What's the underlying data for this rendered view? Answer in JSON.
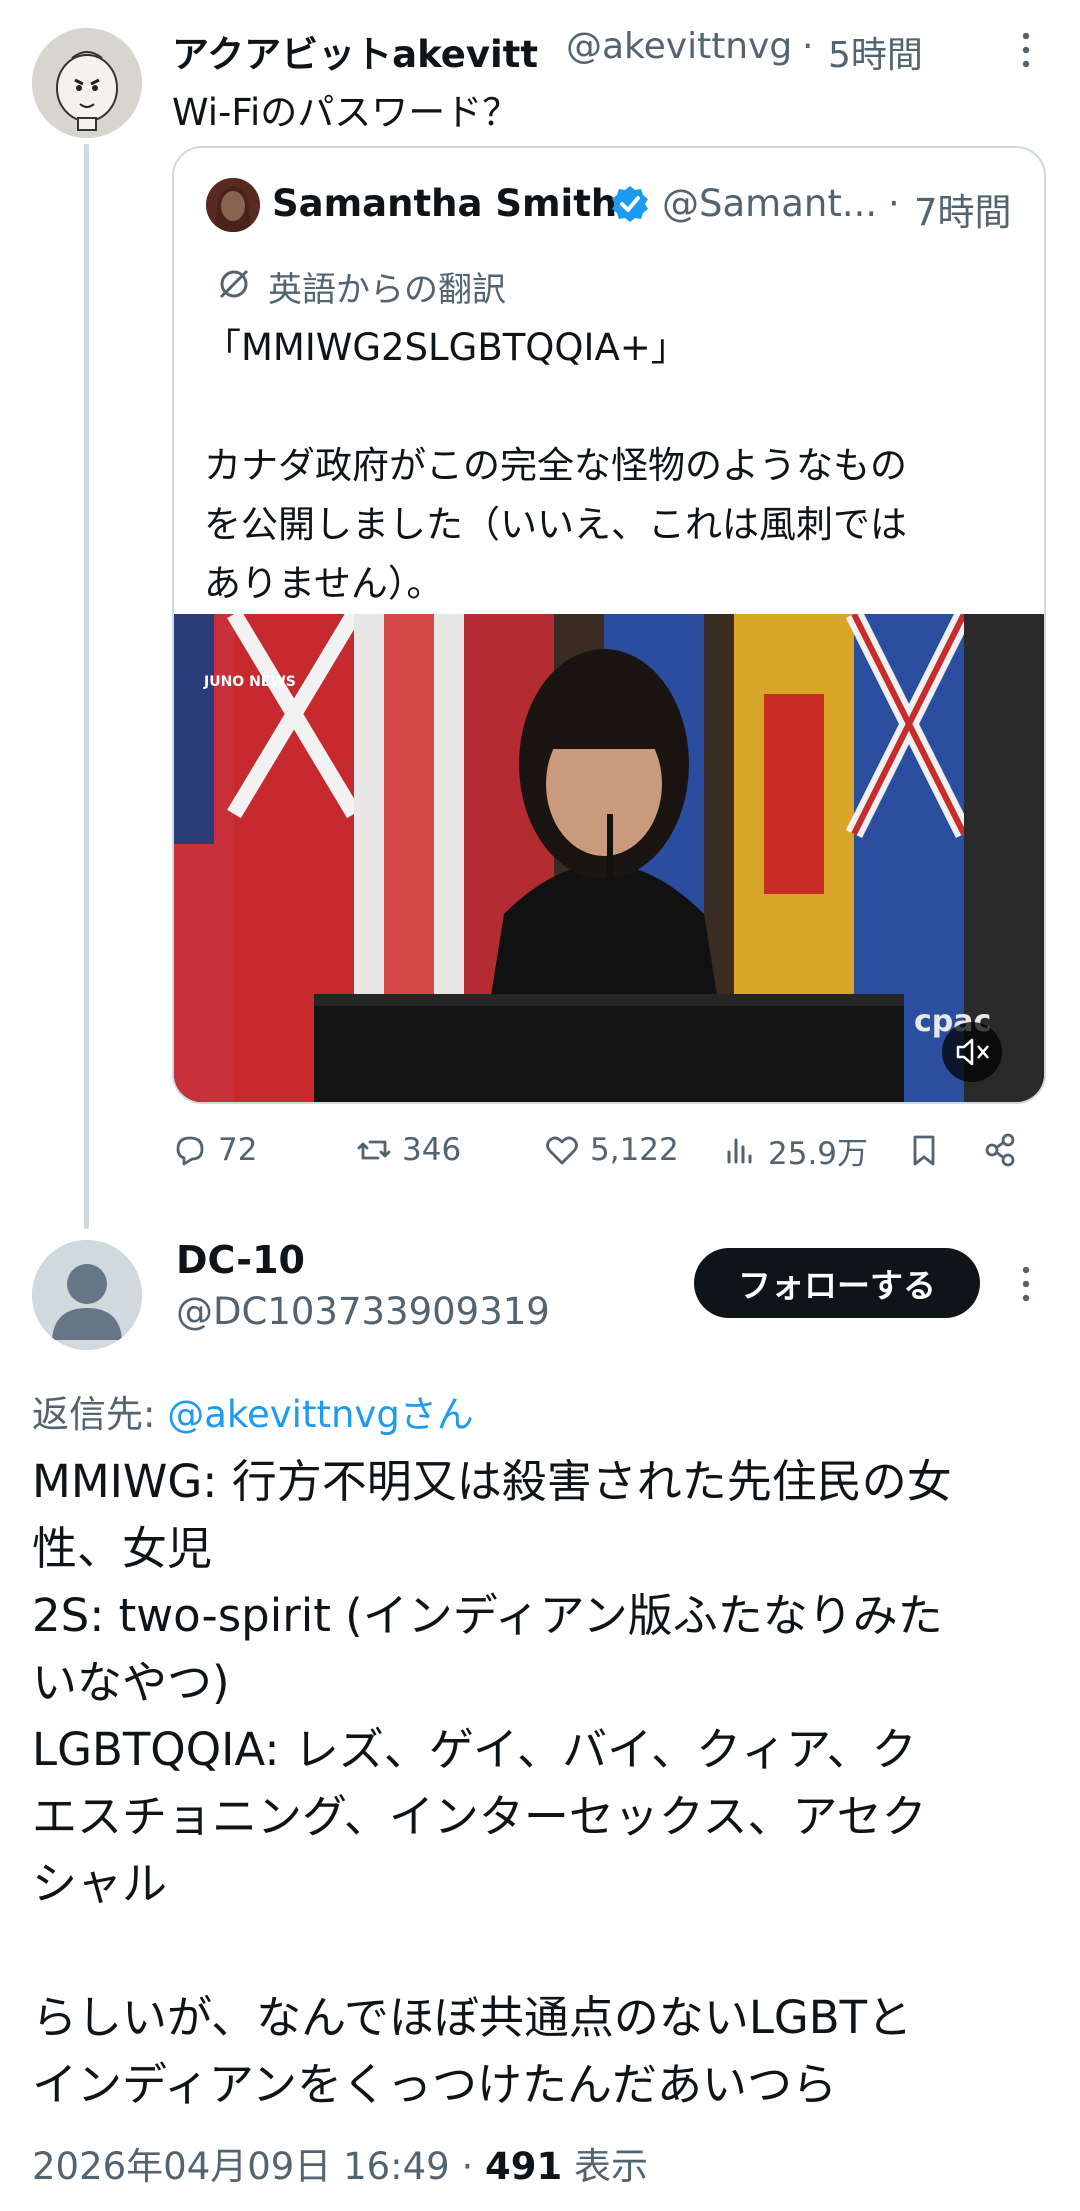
{
  "parent_tweet": {
    "display_name": "アクアビットakevitt",
    "handle": "@akevittnvg",
    "separator": "·",
    "time": "5時間",
    "text": "Wi-Fiのパスワード？"
  },
  "quoted_tweet": {
    "display_name": "Samantha Smith",
    "handle": "@Samant...",
    "separator": "·",
    "time": "7時間",
    "translation_label": "英語からの翻訳",
    "body": [
      "「MMIWG2SLGBTQQIA+」",
      "",
      "カナダ政府がこの完全な怪物のようなもの",
      "を公開しました（いいえ、これは風刺では",
      "ありません）。"
    ],
    "video": {
      "watermark": "JUNO NEWS",
      "broadcaster": "cpac",
      "mute_icon": "speaker-muted-icon"
    }
  },
  "actions": {
    "replies": "72",
    "reposts": "346",
    "likes": "5,122",
    "views": "25.9万"
  },
  "reply_tweet": {
    "display_name": "DC-10",
    "handle": "@DC103733909319",
    "follow_label": "フォローする",
    "reply_to_prefix": "返信先: ",
    "reply_to_user": "@akevittnvgさん",
    "body": [
      "MMIWG: 行方不明又は殺害された先住民の女",
      "性、女児",
      "2S: two-spirit (インディアン版ふたなりみた",
      "いなやつ)",
      "LGBTQQIA: レズ、ゲイ、バイ、クィア、ク",
      "エスチョニング、インターセックス、アセク",
      "シャル",
      "",
      "らしいが、なんでほぼ共通点のないLGBTと",
      "インディアンをくっつけたんだあいつら"
    ],
    "timestamp": "2026年04月09日 16:49",
    "separator": "·",
    "view_count": "491",
    "view_label": "表示"
  },
  "colors": {
    "text": "#0f1419",
    "muted": "#536471",
    "link": "#1d9bf0",
    "border": "#cfd9de",
    "verified": "#1d9bf0"
  }
}
